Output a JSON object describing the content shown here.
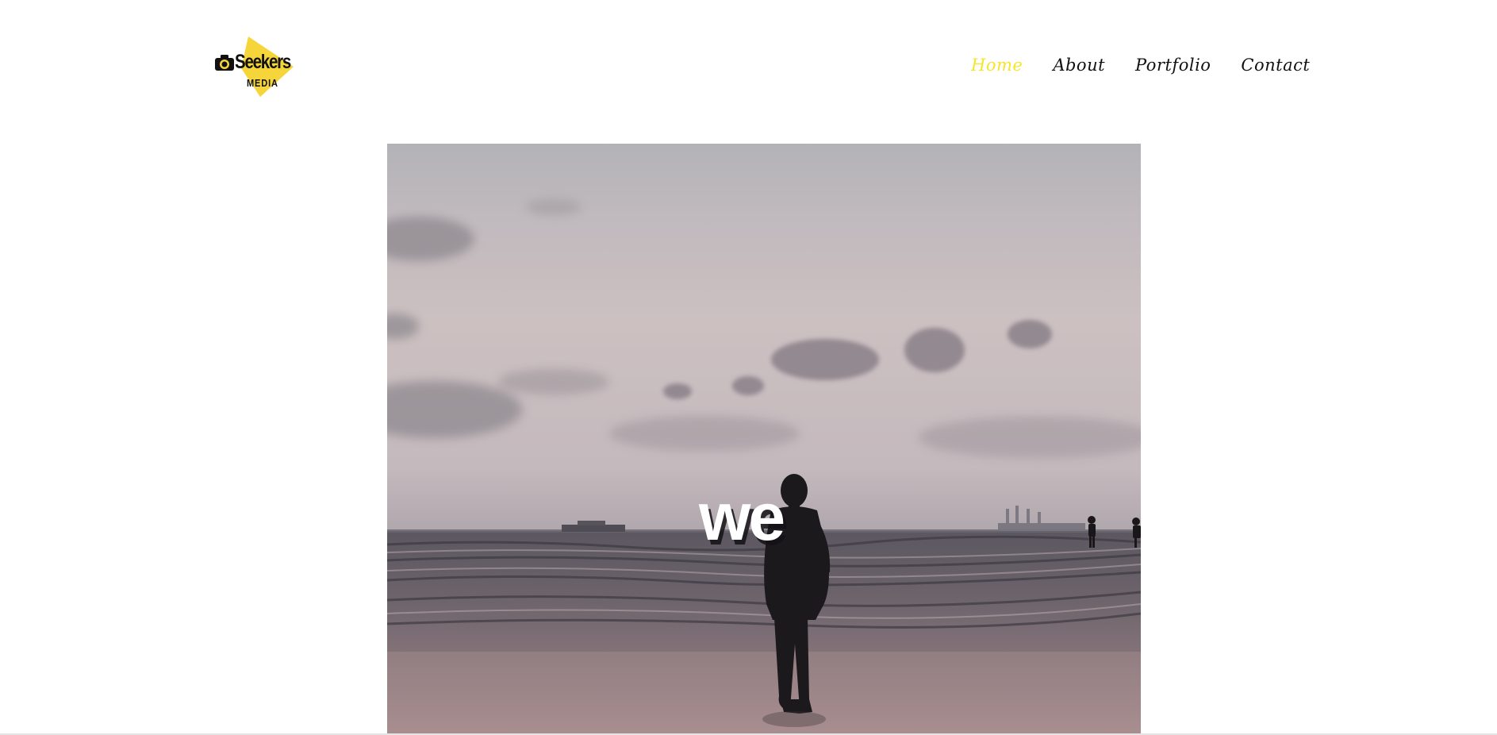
{
  "brand": {
    "name": "Seekers",
    "subtitle": "MEDIA",
    "accent_color": "#f5d53a",
    "icon": "camera-icon"
  },
  "nav": {
    "items": [
      {
        "label": "Home",
        "active": true
      },
      {
        "label": "About",
        "active": false
      },
      {
        "label": "Portfolio",
        "active": false
      },
      {
        "label": "Contact",
        "active": false
      }
    ],
    "active_color": "#f5e62a",
    "text_color": "#111111"
  },
  "hero": {
    "overlay_text": "we",
    "media": "beach-sunset-video"
  }
}
